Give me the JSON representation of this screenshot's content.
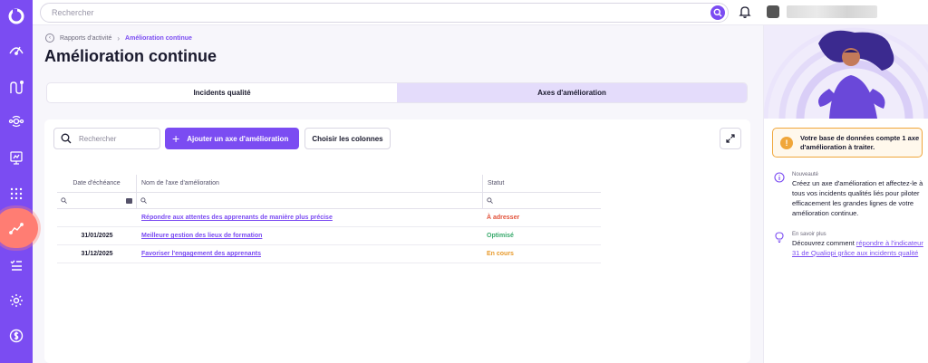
{
  "topbar": {
    "search_placeholder": "Rechercher"
  },
  "breadcrumb": {
    "parent": "Rapports d'activité",
    "current": "Amélioration continue"
  },
  "page": {
    "title": "Amélioration continue"
  },
  "tabs": [
    {
      "label": "Incidents qualité",
      "active": false
    },
    {
      "label": "Axes d'amélioration",
      "active": true
    }
  ],
  "toolbar": {
    "search_placeholder": "Rechercher",
    "add_label": "Ajouter un axe d'amélioration",
    "columns_label": "Choisir les colonnes"
  },
  "table": {
    "headers": [
      "Date d'échéance",
      "Nom de l'axe d'amélioration",
      "Statut"
    ],
    "rows": [
      {
        "date": "",
        "name": "Répondre aux attentes des apprenants de manière plus précise",
        "status": "À adresser",
        "status_color": "#e2533b"
      },
      {
        "date": "31/01/2025",
        "name": "Meilleure gestion des lieux de formation",
        "status": "Optimisé",
        "status_color": "#3aaa6d"
      },
      {
        "date": "31/12/2025",
        "name": "Favoriser l'engagement des apprenants",
        "status": "En cours",
        "status_color": "#e89a2b"
      }
    ]
  },
  "panel": {
    "alert": "Votre base de données compte 1 axe d'amélioration à traiter.",
    "news_label": "Nouveauté",
    "news_body": "Créez un axe d'amélioration et affectez-le à tous vos incidents qualités liés pour piloter efficacement les grandes lignes de votre amélioration continue.",
    "more_label": "En savoir plus",
    "more_body": "Découvrez comment ",
    "more_link": "répondre à l'indicateur 31 de Qualiopi grâce aux incidents qualité"
  },
  "colors": {
    "accent": "#7b4cf2",
    "sidebar": "#7b4cf2",
    "active_nav": "#ff7d73",
    "alert_border": "#f0a63a"
  },
  "icons": {
    "sidebar": [
      "logo-icon",
      "dashboard-icon",
      "journey-icon",
      "network-icon",
      "report-icon",
      "grid-icon",
      "improvement-icon",
      "list-icon",
      "settings-icon",
      "money-icon"
    ]
  }
}
